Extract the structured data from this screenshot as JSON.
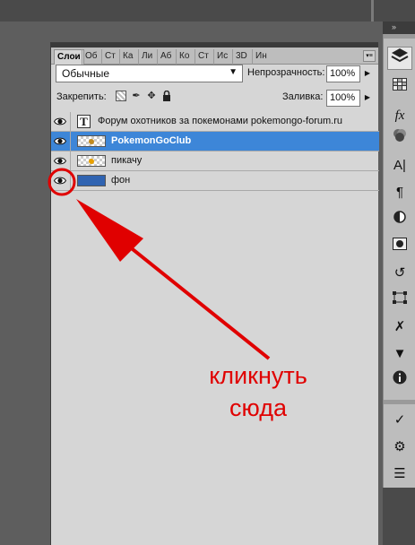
{
  "panel": {
    "tabs": [
      "Слои",
      "Об",
      "Ст",
      "Ка",
      "Ли",
      "Аб",
      "Ко",
      "Ст",
      "Ис",
      "3D",
      "Ин"
    ],
    "collapse_glyph": "»",
    "menu_glyph": "▾≡",
    "blend_mode": "Обычные",
    "opacity_label": "Непрозрачность:",
    "opacity_value": "100%",
    "lock_label": "Закрепить:",
    "fill_label": "Заливка:",
    "fill_value": "100%"
  },
  "layers": [
    {
      "name": "Форум охотников за покемонами  pokemongo-forum.ru",
      "type": "text",
      "visible": true,
      "selected": false
    },
    {
      "name": "PokemonGoClub",
      "type": "image",
      "visible": true,
      "selected": true
    },
    {
      "name": "пикачу",
      "type": "image",
      "visible": true,
      "selected": false
    },
    {
      "name": "фон",
      "type": "fill",
      "visible": true,
      "selected": false
    }
  ],
  "annotation": {
    "line1": "кликнуть",
    "line2": "сюда",
    "color": "#e00000"
  },
  "toolbar": {
    "icons": [
      "layers-icon",
      "swatches-icon",
      "fx-styles-icon",
      "channels-icon",
      "character-icon",
      "paragraph-icon",
      "adjustments-icon",
      "masks-icon",
      "history-icon",
      "paths-icon",
      "tools-icon",
      "actions-icon",
      "info-icon",
      "brush-presets-icon",
      "clone-source-icon",
      "tool-presets-icon"
    ]
  },
  "colors": {
    "selection": "#3d86d8",
    "panel_bg": "#d6d6d6",
    "background": "#5e5e5e"
  }
}
